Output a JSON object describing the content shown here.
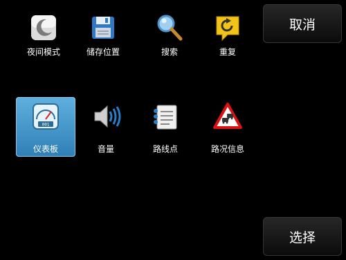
{
  "menu": {
    "items": [
      {
        "label": "夜间模式",
        "icon": "night-mode-icon"
      },
      {
        "label": "储存位置",
        "icon": "save-location-icon"
      },
      {
        "label": "搜索",
        "icon": "search-icon"
      },
      {
        "label": "重复",
        "icon": "repeat-icon"
      },
      {
        "label": "仪表板",
        "icon": "dashboard-icon",
        "selected": true
      },
      {
        "label": "音量",
        "icon": "volume-icon"
      },
      {
        "label": "路线点",
        "icon": "waypoints-icon"
      },
      {
        "label": "路况信息",
        "icon": "traffic-info-icon"
      }
    ]
  },
  "buttons": {
    "cancel_label": "取消",
    "select_label": "选择"
  },
  "colors": {
    "background": "#000000",
    "selection": "#3f95cc"
  }
}
